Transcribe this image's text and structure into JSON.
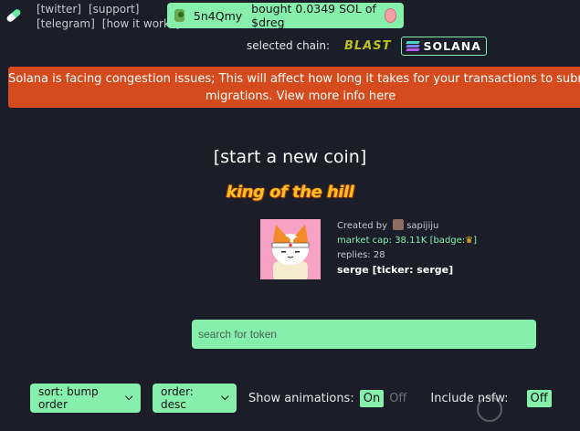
{
  "nav": {
    "links_row1": [
      "[twitter]",
      "[support]"
    ],
    "links_row2": [
      "[telegram]",
      "[how it works]"
    ]
  },
  "ticker": {
    "user": "5n4Qmy",
    "action": "bought 0.0349 SOL of $dreg"
  },
  "chain": {
    "label": "selected chain:",
    "options": [
      "BLAST",
      "SOLANA"
    ],
    "selected": "SOLANA"
  },
  "banner": {
    "text": "Solana is facing congestion issues; This will affect how long it takes for your transactions to submit and migrations. View more info here",
    "line1": "Solana is facing congestion issues; This will affect how long it takes for your transactions to submit an",
    "line2": "migrations. View more info here",
    "color": "#d64b1e"
  },
  "main": {
    "new_coin": "[start a new coin]",
    "king_title": "king of the hill"
  },
  "featured": {
    "created_by_label": "Created by",
    "creator": "sapijiju",
    "market_cap": "market cap: 38.11K",
    "badge": "[badge:",
    "replies": "replies: 28",
    "name": "serge [ticker: serge]"
  },
  "search": {
    "placeholder": "search for token"
  },
  "controls": {
    "sort": "sort: bump order",
    "order": "order: desc",
    "animations_label": "Show animations:",
    "on": "On",
    "off": "Off",
    "nsfw_label": "Include nsfw:",
    "nsfw_value": "Off"
  },
  "colors": {
    "background": "#1b1d28",
    "accent": "#86efac",
    "banner": "#d64b1e"
  }
}
